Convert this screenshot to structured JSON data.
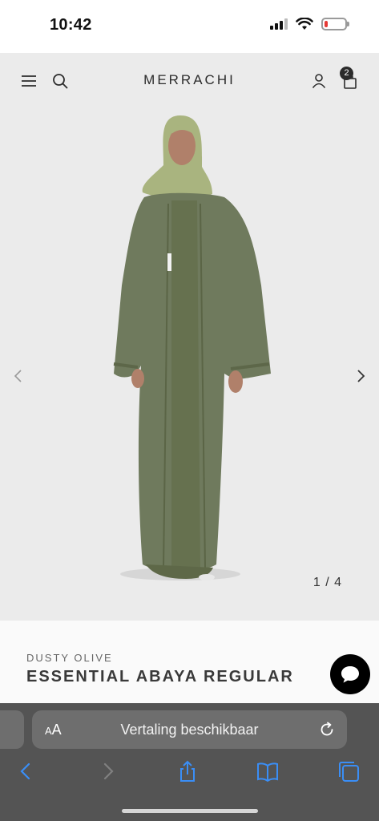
{
  "status_bar": {
    "time": "10:42",
    "signal_bars": 3,
    "battery_level": 0.15,
    "battery_color": "#e53935"
  },
  "header": {
    "brand": "MERRACHI",
    "menu_icon": "hamburger-menu-icon",
    "search_icon": "search-icon",
    "account_icon": "user-icon",
    "cart_icon": "shopping-bag-icon",
    "cart_count": "2"
  },
  "gallery": {
    "counter": "1 / 4",
    "prev_icon": "chevron-left-icon",
    "next_icon": "chevron-right-icon",
    "image_subject": "model wearing olive abaya",
    "garment_color": "#6f7a5d",
    "hijab_color": "#a9b47f"
  },
  "product": {
    "color_name": "DUSTY OLIVE",
    "title": "ESSENTIAL ABAYA REGULAR"
  },
  "chat": {
    "icon": "chat-bubble-icon"
  },
  "browser": {
    "aa_label_small": "A",
    "aa_label_large": "A",
    "address_text": "Vertaling beschikbaar",
    "reload_icon": "reload-icon",
    "toolbar": {
      "back_icon": "back-arrow-icon",
      "forward_icon": "forward-arrow-icon",
      "share_icon": "share-icon",
      "bookmarks_icon": "bookmarks-icon",
      "tabs_icon": "tabs-icon"
    },
    "accent": "#3a8ef6"
  }
}
